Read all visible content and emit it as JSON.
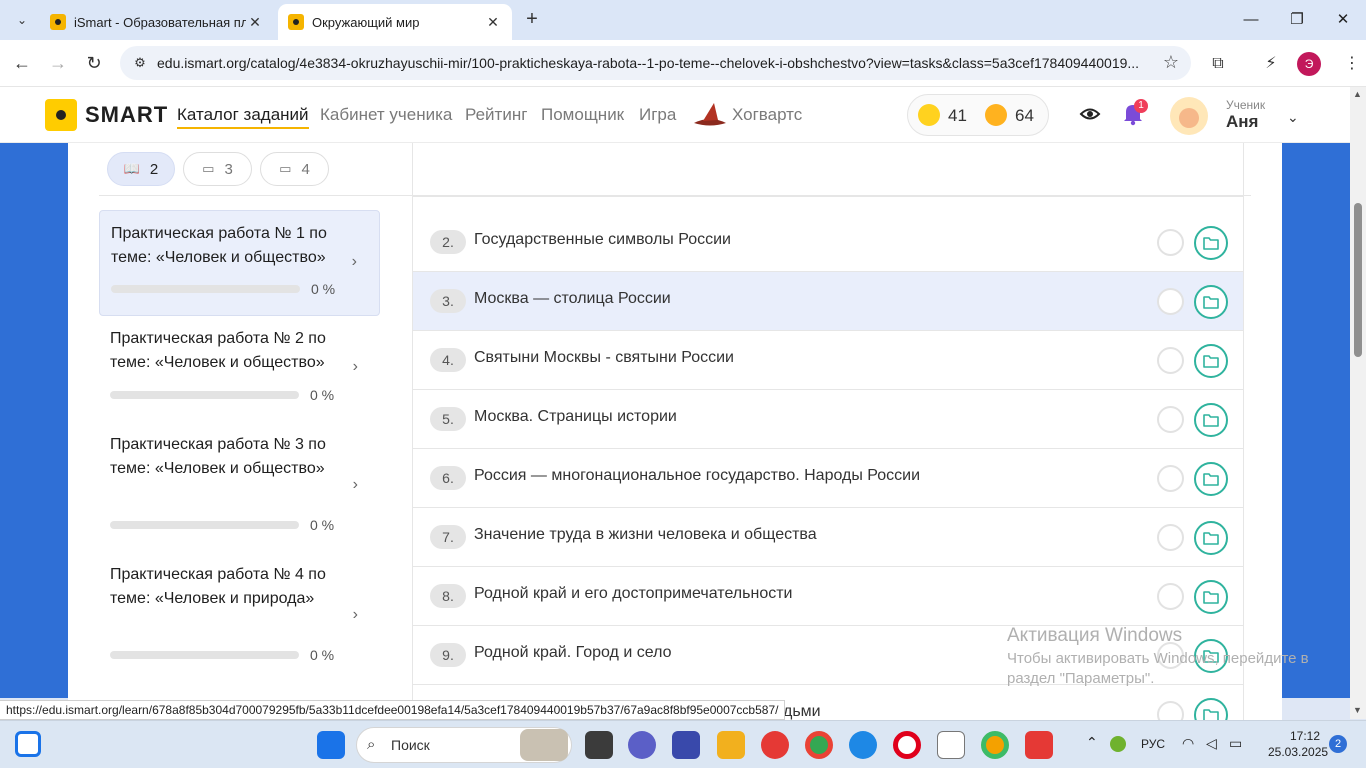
{
  "browser": {
    "tabs": [
      {
        "title": "iSmart - Образовательная пла",
        "active": false
      },
      {
        "title": "Окружающий мир",
        "active": true
      }
    ],
    "url": "edu.ismart.org/catalog/4e3834-okruzhayuschii-mir/100-prakticheskaya-rabota--1-po-teme--chelovek-i-obshchestvo?view=tasks&class=5a3cef178409440019...",
    "profile_initial": "Э"
  },
  "site": {
    "logo": "SMART",
    "nav": [
      "Каталог заданий",
      "Кабинет ученика",
      "Рейтинг",
      "Помощник",
      "Игра",
      "Хогвартс"
    ],
    "stats": {
      "coins": "41",
      "smiles": "64"
    },
    "notifications": "1",
    "user": {
      "role": "Ученик",
      "name": "Аня"
    }
  },
  "class_tabs": [
    {
      "label": "2",
      "active": true
    },
    {
      "label": "3",
      "active": false
    },
    {
      "label": "4",
      "active": false
    }
  ],
  "works": [
    {
      "title": "Практическая работа № 1 по теме: «Человек и общество»",
      "progress": "0 %",
      "progress_value": 0
    },
    {
      "title": "Практическая работа № 2 по теме: «Человек и общество»",
      "progress": "0 %",
      "progress_value": 0
    },
    {
      "title": "Практическая работа № 3 по теме: «Человек и общество»",
      "progress": "0 %",
      "progress_value": 0
    },
    {
      "title": "Практическая работа № 4 по теме: «Человек и природа»",
      "progress": "0 %",
      "progress_value": 0
    }
  ],
  "tasks": [
    {
      "num": "2.",
      "title": "Государственные символы России"
    },
    {
      "num": "3.",
      "title": "Москва — столица России"
    },
    {
      "num": "4.",
      "title": "Святыни Москвы - святыни России"
    },
    {
      "num": "5.",
      "title": "Москва. Страницы истории"
    },
    {
      "num": "6.",
      "title": "Россия — многонациональное государство. Народы России"
    },
    {
      "num": "7.",
      "title": "Значение труда в жизни человека и общества"
    },
    {
      "num": "8.",
      "title": "Родной край и его достопримечательности"
    },
    {
      "num": "9.",
      "title": "Родной край. Город и село"
    },
    {
      "num": "",
      "title": "дьми"
    }
  ],
  "watermark": {
    "title": "Активация Windows",
    "text": "Чтобы активировать Windows, перейдите в раздел \"Параметры\"."
  },
  "status_url": "https://edu.ismart.org/learn/678a8f85b304d700079295fb/5a33b11dcefdee00198efa14/5a3cef178409440019b57b37/67a9ac8f8bf95e0007ccb587/",
  "taskbar": {
    "search": "Поиск",
    "lang": "РУС",
    "time": "17:12",
    "date": "25.03.2025",
    "notifications": "2"
  },
  "colors": {
    "accent": "#2f6fd6",
    "brand_yellow": "#ffcc00",
    "folder_teal": "#2fb39e"
  }
}
